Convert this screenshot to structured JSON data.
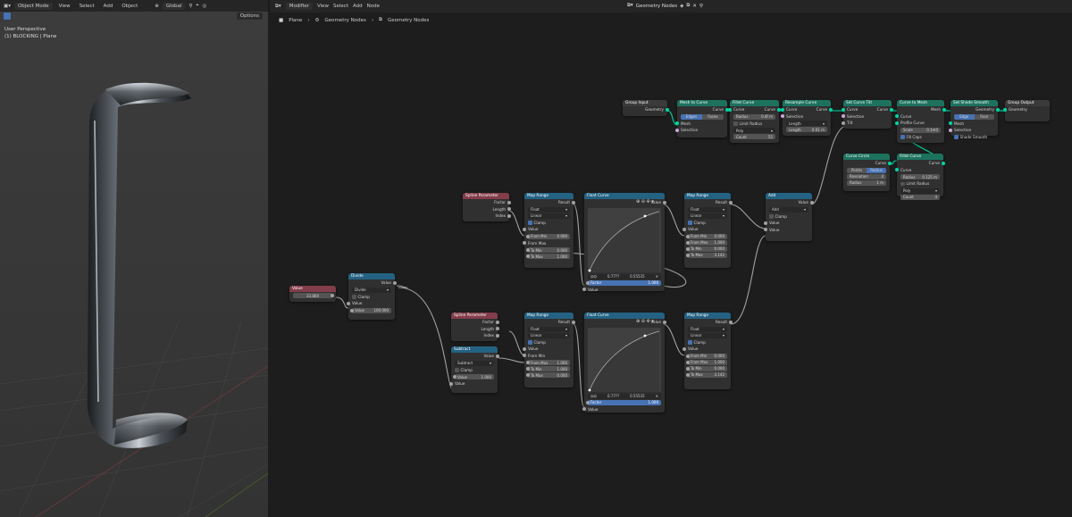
{
  "viewport": {
    "mode": "Object Mode",
    "menus": [
      "View",
      "Select",
      "Add",
      "Object"
    ],
    "orientation": "Global",
    "options": "Options",
    "perspective": "User Perspective",
    "object_info": "(1) BLOCKING | Plane"
  },
  "node_editor": {
    "editor_type": "Modifier",
    "menus": [
      "View",
      "Select",
      "Add",
      "Node"
    ],
    "tree_name": "Geometry Nodes",
    "breadcrumb": [
      "Plane",
      "Geometry Nodes",
      "Geometry Nodes"
    ]
  },
  "nodes": {
    "group_input": {
      "title": "Group Input",
      "out": "Geometry"
    },
    "mesh_to_curve": {
      "title": "Mesh to Curve",
      "out": "Curve",
      "mode": [
        "Edges",
        "Faces"
      ],
      "in": [
        "Mesh",
        "Selection"
      ]
    },
    "fillet1": {
      "title": "Fillet Curve",
      "out": "Curve",
      "in_curve": "Curve",
      "radius_label": "Radius",
      "radius": "0.4f m",
      "limit": "Limit Radius",
      "mode": "Poly",
      "count_label": "Count",
      "count": "55"
    },
    "resample": {
      "title": "Resample Curve",
      "in_curve": "Curve",
      "out": "Curve",
      "selection": "Selection",
      "mode": "Length",
      "length_label": "Length",
      "length": "0.01 m"
    },
    "set_tilt": {
      "title": "Set Curve Tilt",
      "out": "Curve",
      "in_curve": "Curve",
      "selection": "Selection",
      "tilt": "Tilt"
    },
    "curve_to_mesh": {
      "title": "Curve to Mesh",
      "out": "Mesh",
      "curve": "Curve",
      "profile": "Profile Curve",
      "scale_label": "Scale",
      "scale": "0.1m0",
      "fill": "Fill Caps"
    },
    "shade_smooth": {
      "title": "Set Shade Smooth",
      "out": "Geometry",
      "mode": [
        "Edge",
        "Face"
      ],
      "mesh": "Mesh",
      "selection": "Selection",
      "smooth": "Shade Smooth"
    },
    "group_output": {
      "title": "Group Output",
      "in": "Geometry"
    },
    "curve_circle": {
      "title": "Curve Circle",
      "out": "Curve",
      "mode": [
        "Points",
        "Radius"
      ],
      "res_label": "Resolution",
      "res": "4",
      "rad_label": "Radius",
      "rad": "1 m"
    },
    "fillet2": {
      "title": "Fillet Curve",
      "out": "Curve",
      "in_curve": "Curve",
      "radius_label": "Radius",
      "radius": "0.125 m",
      "limit": "Limit Radius",
      "mode": "Poly",
      "count_label": "Count",
      "count": "4"
    },
    "spline1": {
      "title": "Spline Parameter",
      "outs": [
        "Factor",
        "Length",
        "Index"
      ]
    },
    "maprange1": {
      "title": "Map Range",
      "out": "Result",
      "type": "Float",
      "interp": "Linear",
      "clamp": "Clamp",
      "value": "Value",
      "rows": [
        [
          "From Min",
          "0.000"
        ],
        [
          "From Max",
          ""
        ],
        [
          "To Min",
          "0.000"
        ],
        [
          "To Max",
          "1.000"
        ]
      ]
    },
    "floatcurve1": {
      "title": "Float Curve",
      "out": "Value",
      "x": "0.77??",
      "y": "0.55535",
      "factor_label": "Factor",
      "factor": "1.000",
      "value": "Value"
    },
    "maprange2": {
      "title": "Map Range",
      "out": "Result",
      "type": "Float",
      "interp": "Linear",
      "clamp": "Clamp",
      "value": "Value",
      "rows": [
        [
          "From Min",
          "0.000"
        ],
        [
          "From Max",
          "1.000"
        ],
        [
          "To Min",
          "0.000"
        ],
        [
          "To Max",
          "3.142"
        ]
      ]
    },
    "add": {
      "title": "Add",
      "out": "Value",
      "op": "Add",
      "clamp": "Clamp",
      "ins": [
        "Value",
        "Value"
      ]
    },
    "value": {
      "title": "Value",
      "val": "33.860"
    },
    "divide": {
      "title": "Divide",
      "out": "Value",
      "op": "Divide",
      "clamp": "Clamp",
      "in": "Value",
      "val_label": "Value",
      "val": "100.000"
    },
    "spline2": {
      "title": "Spline Parameter",
      "outs": [
        "Factor",
        "Length",
        "Index"
      ]
    },
    "subtract": {
      "title": "Subtract",
      "out": "Value",
      "op": "Subtract",
      "clamp": "Clamp",
      "val_label": "Value",
      "val": "1.000",
      "in": "Value"
    },
    "maprange3": {
      "title": "Map Range",
      "out": "Result",
      "type": "Float",
      "interp": "Linear",
      "clamp": "Clamp",
      "value": "Value",
      "rows": [
        [
          "From Min",
          ""
        ],
        [
          "From Max",
          "1.000"
        ],
        [
          "To Min",
          "1.000"
        ],
        [
          "To Max",
          "0.000"
        ]
      ]
    },
    "floatcurve2": {
      "title": "Float Curve",
      "out": "Value",
      "x": "0.77??",
      "y": "0.55535",
      "factor_label": "Factor",
      "factor": "1.000",
      "value": "Value"
    },
    "maprange4": {
      "title": "Map Range",
      "out": "Result",
      "type": "Float",
      "interp": "Linear",
      "clamp": "Clamp",
      "value": "Value",
      "rows": [
        [
          "From Min",
          "0.000"
        ],
        [
          "From Max",
          "1.000"
        ],
        [
          "To Min",
          "0.000"
        ],
        [
          "To Max",
          "3.142"
        ]
      ]
    }
  }
}
